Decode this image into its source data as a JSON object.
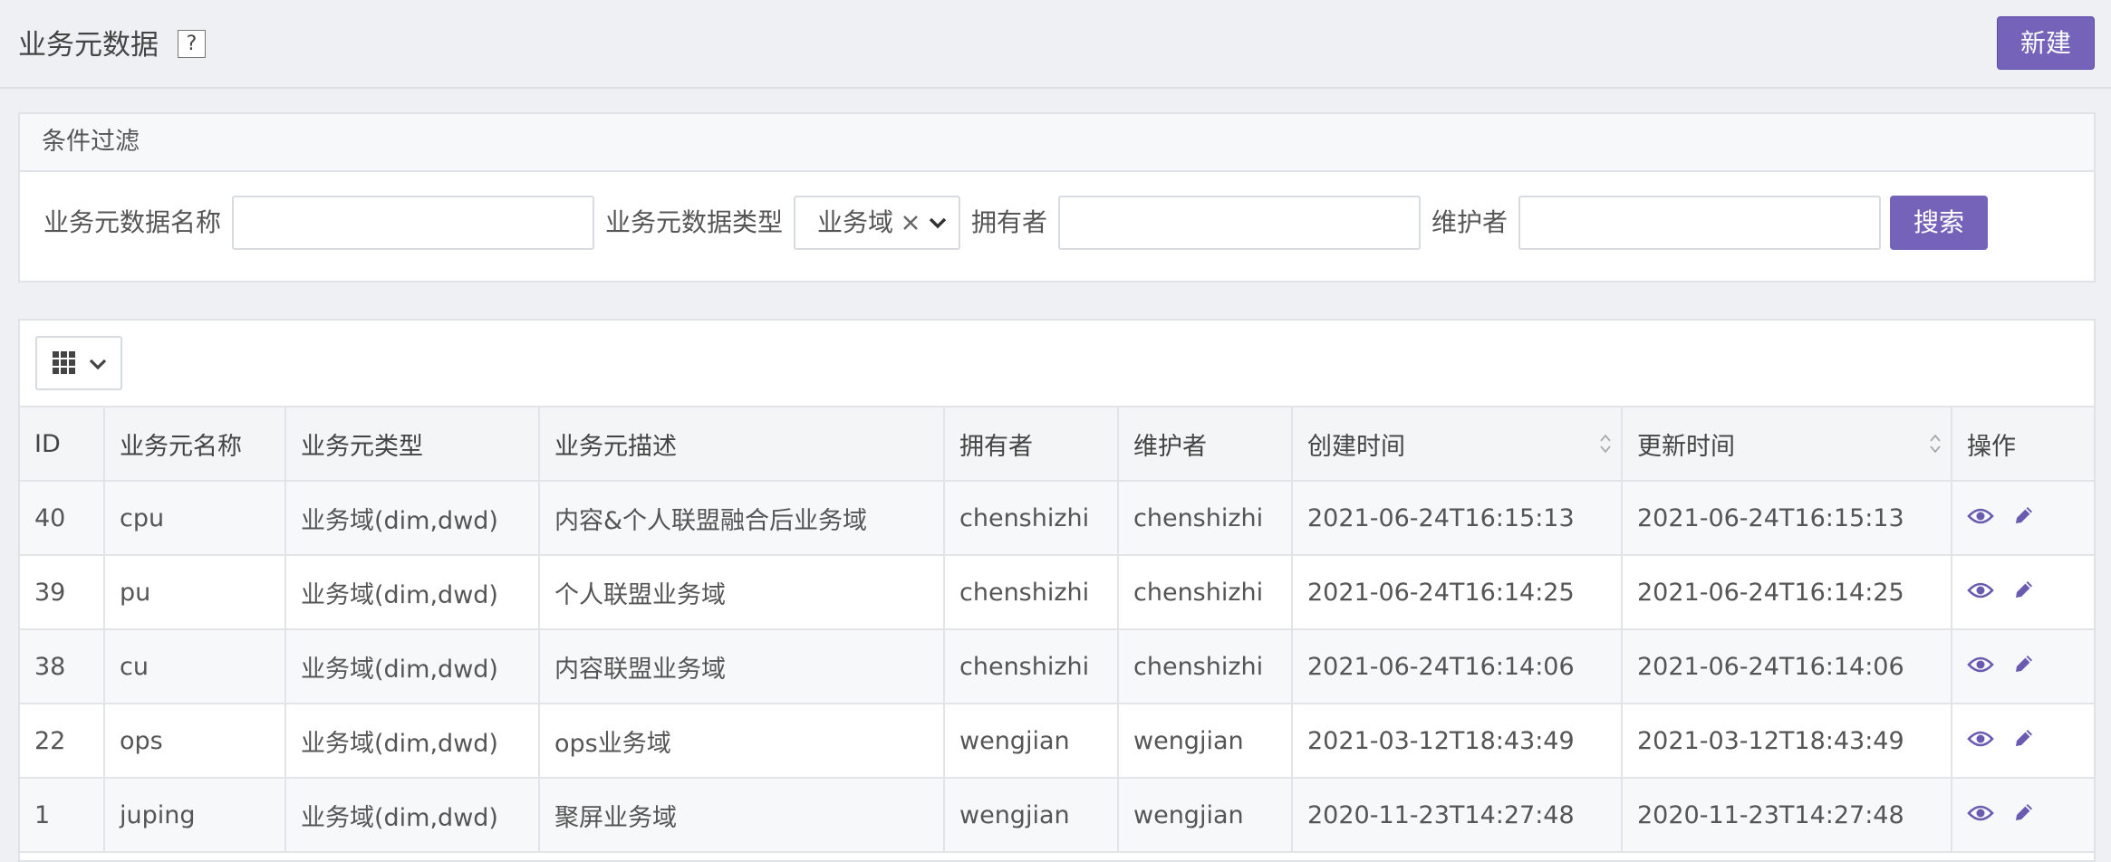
{
  "header": {
    "title": "业务元数据",
    "help_label": "?",
    "new_label": "新建"
  },
  "filter": {
    "title": "条件过滤",
    "name_label": "业务元数据名称",
    "name_value": "",
    "type_label": "业务元数据类型",
    "type_value": "业务域",
    "owner_label": "拥有者",
    "owner_value": "",
    "maintainer_label": "维护者",
    "maintainer_value": "",
    "search_label": "搜索"
  },
  "table": {
    "columns": [
      "ID",
      "业务元名称",
      "业务元类型",
      "业务元描述",
      "拥有者",
      "维护者",
      "创建时间",
      "更新时间",
      "操作"
    ],
    "rows": [
      {
        "id": "40",
        "name": "cpu",
        "type": "业务域(dim,dwd)",
        "desc": "内容&个人联盟融合后业务域",
        "owner": "chenshizhi",
        "maintainer": "chenshizhi",
        "created": "2021-06-24T16:15:13",
        "updated": "2021-06-24T16:15:13"
      },
      {
        "id": "39",
        "name": "pu",
        "type": "业务域(dim,dwd)",
        "desc": "个人联盟业务域",
        "owner": "chenshizhi",
        "maintainer": "chenshizhi",
        "created": "2021-06-24T16:14:25",
        "updated": "2021-06-24T16:14:25"
      },
      {
        "id": "38",
        "name": "cu",
        "type": "业务域(dim,dwd)",
        "desc": "内容联盟业务域",
        "owner": "chenshizhi",
        "maintainer": "chenshizhi",
        "created": "2021-06-24T16:14:06",
        "updated": "2021-06-24T16:14:06"
      },
      {
        "id": "22",
        "name": "ops",
        "type": "业务域(dim,dwd)",
        "desc": "ops业务域",
        "owner": "wengjian",
        "maintainer": "wengjian",
        "created": "2021-03-12T18:43:49",
        "updated": "2021-03-12T18:43:49"
      },
      {
        "id": "1",
        "name": "juping",
        "type": "业务域(dim,dwd)",
        "desc": "聚屏业务域",
        "owner": "wengjian",
        "maintainer": "wengjian",
        "created": "2020-11-23T14:27:48",
        "updated": "2020-11-23T14:27:48"
      }
    ]
  },
  "colors": {
    "accent": "#7463b8",
    "icon": "#6a5ab0"
  },
  "icons": {
    "view": "eye-icon",
    "edit": "pencil-icon",
    "columns": "grid-icon",
    "sort": "sort-icon"
  }
}
